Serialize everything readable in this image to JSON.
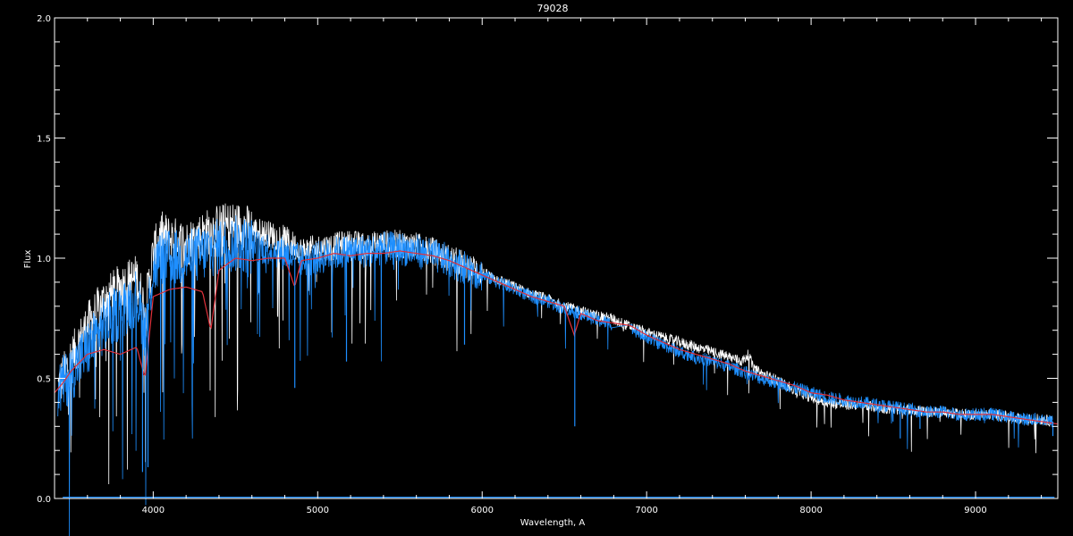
{
  "chart_data": {
    "type": "line",
    "title": "79028",
    "xlabel": "Wavelength, A",
    "ylabel": "Flux",
    "xlim": [
      3400,
      9500
    ],
    "ylim": [
      0.0,
      2.0
    ],
    "x_ticks": [
      4000,
      5000,
      6000,
      7000,
      8000,
      9000
    ],
    "x_tick_labels": [
      "4000",
      "5000",
      "6000",
      "7000",
      "8000",
      "9000"
    ],
    "y_ticks": [
      0.0,
      0.5,
      1.0,
      1.5,
      2.0
    ],
    "y_tick_labels": [
      "0.0",
      "0.5",
      "1.0",
      "1.5",
      "2.0"
    ],
    "grid": false,
    "colors": {
      "background": "#000000",
      "axes": "#ffffff",
      "observed": "#ffffff",
      "model": "#1e8fff",
      "fit": "#e0303a"
    },
    "series": [
      {
        "color": "#ffffff",
        "x": [
          3420,
          3500,
          3600,
          3700,
          3800,
          3900,
          3950,
          4000,
          4050,
          4100,
          4200,
          4300,
          4400,
          4500,
          4600,
          4700,
          4800,
          4900,
          5000,
          5100,
          5200,
          5300,
          5400,
          5500,
          5600,
          5700,
          5800,
          5900,
          6000,
          6100,
          6200,
          6300,
          6400,
          6500,
          6600,
          6700,
          6780,
          6920,
          7000,
          7100,
          7200,
          7300,
          7400,
          7500,
          7580,
          7620,
          7650,
          7700,
          7800,
          7900,
          8000,
          8100,
          8200,
          8300,
          8400,
          8500,
          8600,
          8700,
          8800,
          8900,
          9000,
          9100,
          9200,
          9300,
          9400,
          9470
        ],
        "y": [
          0.46,
          0.58,
          0.72,
          0.82,
          0.88,
          0.92,
          0.78,
          1.02,
          1.1,
          1.08,
          1.06,
          1.1,
          1.13,
          1.14,
          1.12,
          1.1,
          1.08,
          1.03,
          1.04,
          1.05,
          1.06,
          1.05,
          1.06,
          1.06,
          1.05,
          1.03,
          1.0,
          0.97,
          0.94,
          0.91,
          0.88,
          0.85,
          0.83,
          0.8,
          0.78,
          0.76,
          0.75,
          0.71,
          0.69,
          0.67,
          0.65,
          0.63,
          0.61,
          0.59,
          0.57,
          0.6,
          0.54,
          0.52,
          0.49,
          0.45,
          0.42,
          0.4,
          0.39,
          0.39,
          0.38,
          0.37,
          0.37,
          0.36,
          0.36,
          0.35,
          0.35,
          0.35,
          0.34,
          0.33,
          0.33,
          0.32
        ]
      },
      {
        "color": "#1e8fff",
        "x": [
          3420,
          3500,
          3600,
          3700,
          3800,
          3900,
          3950,
          4000,
          4050,
          4100,
          4200,
          4300,
          4400,
          4500,
          4600,
          4700,
          4800,
          4900,
          5000,
          5100,
          5200,
          5300,
          5400,
          5500,
          5600,
          5700,
          5800,
          5900,
          6000,
          6100,
          6200,
          6300,
          6400,
          6500,
          6600,
          6700,
          6780,
          6920,
          7000,
          7100,
          7200,
          7300,
          7400,
          7500,
          7580,
          7620,
          7650,
          7700,
          7800,
          7900,
          8000,
          8100,
          8200,
          8300,
          8400,
          8500,
          8600,
          8700,
          8800,
          8900,
          9000,
          9100,
          9200,
          9300,
          9400,
          9470
        ],
        "y": [
          0.45,
          0.52,
          0.62,
          0.72,
          0.78,
          0.84,
          0.7,
          0.95,
          1.0,
          1.0,
          1.0,
          1.02,
          1.05,
          1.06,
          1.05,
          1.04,
          1.02,
          0.99,
          1.0,
          1.02,
          1.03,
          1.03,
          1.04,
          1.04,
          1.03,
          1.01,
          0.99,
          0.96,
          0.93,
          0.9,
          0.87,
          0.84,
          0.82,
          0.79,
          0.77,
          0.74,
          0.73,
          0.7,
          0.67,
          0.64,
          0.61,
          0.59,
          0.57,
          0.55,
          0.53,
          0.52,
          0.51,
          0.5,
          0.48,
          0.46,
          0.44,
          0.42,
          0.41,
          0.4,
          0.39,
          0.38,
          0.37,
          0.36,
          0.36,
          0.35,
          0.35,
          0.35,
          0.34,
          0.33,
          0.33,
          0.32
        ]
      },
      {
        "color": "#e0303a",
        "x": [
          3400,
          3450,
          3500,
          3600,
          3700,
          3800,
          3900,
          3950,
          4000,
          4100,
          4200,
          4300,
          4350,
          4400,
          4500,
          4600,
          4700,
          4800,
          4860,
          4900,
          5000,
          5100,
          5200,
          5300,
          5400,
          5500,
          5600,
          5700,
          5800,
          5900,
          6000,
          6100,
          6200,
          6300,
          6400,
          6500,
          6560,
          6600,
          6700,
          6800,
          6900,
          7000,
          7100,
          7200,
          7300,
          7400,
          7500,
          7600,
          7700,
          7800,
          7900,
          8000,
          8100,
          8200,
          8300,
          8400,
          8500,
          8600,
          8700,
          8800,
          8900,
          9000,
          9100,
          9200,
          9300,
          9400,
          9500
        ],
        "y": [
          0.44,
          0.48,
          0.53,
          0.6,
          0.62,
          0.6,
          0.63,
          0.5,
          0.84,
          0.87,
          0.88,
          0.86,
          0.7,
          0.95,
          1.0,
          0.99,
          1.0,
          1.0,
          0.88,
          0.99,
          1.0,
          1.02,
          1.01,
          1.02,
          1.02,
          1.03,
          1.02,
          1.01,
          0.99,
          0.96,
          0.93,
          0.9,
          0.87,
          0.84,
          0.82,
          0.8,
          0.68,
          0.77,
          0.74,
          0.73,
          0.72,
          0.68,
          0.65,
          0.62,
          0.6,
          0.58,
          0.56,
          0.53,
          0.51,
          0.49,
          0.47,
          0.44,
          0.43,
          0.41,
          0.4,
          0.39,
          0.38,
          0.37,
          0.36,
          0.36,
          0.35,
          0.35,
          0.35,
          0.34,
          0.33,
          0.32,
          0.31
        ]
      }
    ]
  }
}
